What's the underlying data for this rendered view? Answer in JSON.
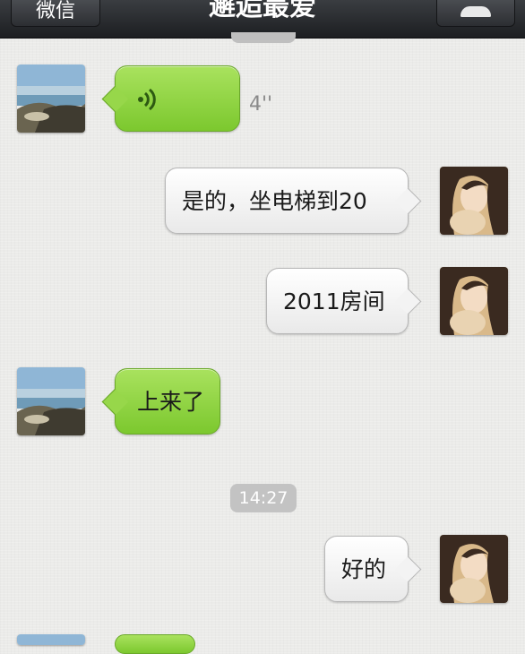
{
  "navbar": {
    "back_label": "微信",
    "title": "邂逅最爱"
  },
  "messages": [
    {
      "side": "left",
      "type": "voice",
      "duration": "4''"
    },
    {
      "side": "right",
      "type": "text",
      "text": "是的，坐电梯到20"
    },
    {
      "side": "right",
      "type": "text",
      "text": "2011房间"
    },
    {
      "side": "left",
      "type": "text",
      "text": "上来了"
    },
    {
      "side": "right",
      "type": "text",
      "text": "好的"
    }
  ],
  "timestamp": "14:27",
  "colors": {
    "incoming_bubble": "#8fd444",
    "outgoing_bubble": "#f7f7f7",
    "navbar": "#26282b",
    "timestamp_bg": "#c3c3c3"
  },
  "icons": [
    "person-icon",
    "voice-wave-icon"
  ]
}
